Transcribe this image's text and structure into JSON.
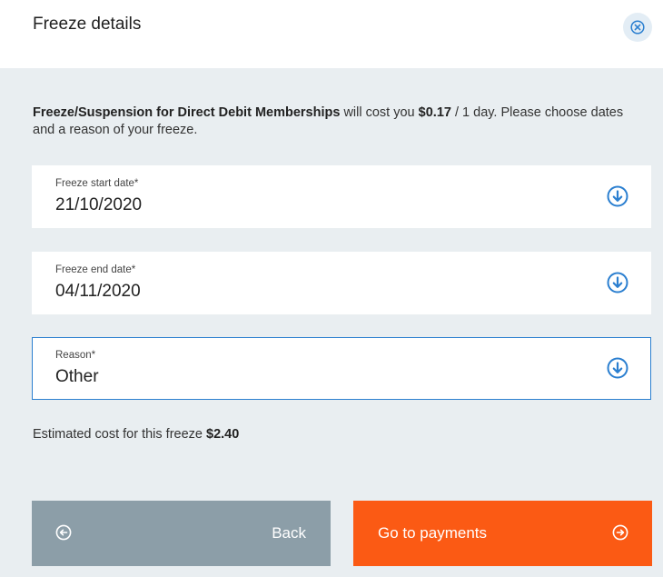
{
  "header": {
    "title": "Freeze details"
  },
  "intro": {
    "plan_name": "Freeze/Suspension for Direct Debit Memberships",
    "cost_prefix": " will cost you ",
    "cost_amount": "$0.17",
    "cost_period": " / 1 day. Please choose dates and a reason of your freeze."
  },
  "fields": {
    "start": {
      "label": "Freeze start date*",
      "value": "21/10/2020"
    },
    "end": {
      "label": "Freeze end date*",
      "value": "04/11/2020"
    },
    "reason": {
      "label": "Reason*",
      "value": "Other"
    }
  },
  "estimate": {
    "label": "Estimated cost for this freeze ",
    "amount": "$2.40"
  },
  "buttons": {
    "back": "Back",
    "pay": "Go to payments"
  },
  "icons": {
    "close": "close-circle-icon",
    "dropdown": "arrow-down-circle-icon",
    "back": "arrow-left-circle-icon",
    "forward": "arrow-right-circle-icon"
  },
  "colors": {
    "accent": "#2b7fd0",
    "primary_button": "#fb5a14",
    "secondary_button": "#8c9ea8",
    "panel_bg": "#e9eef1"
  }
}
